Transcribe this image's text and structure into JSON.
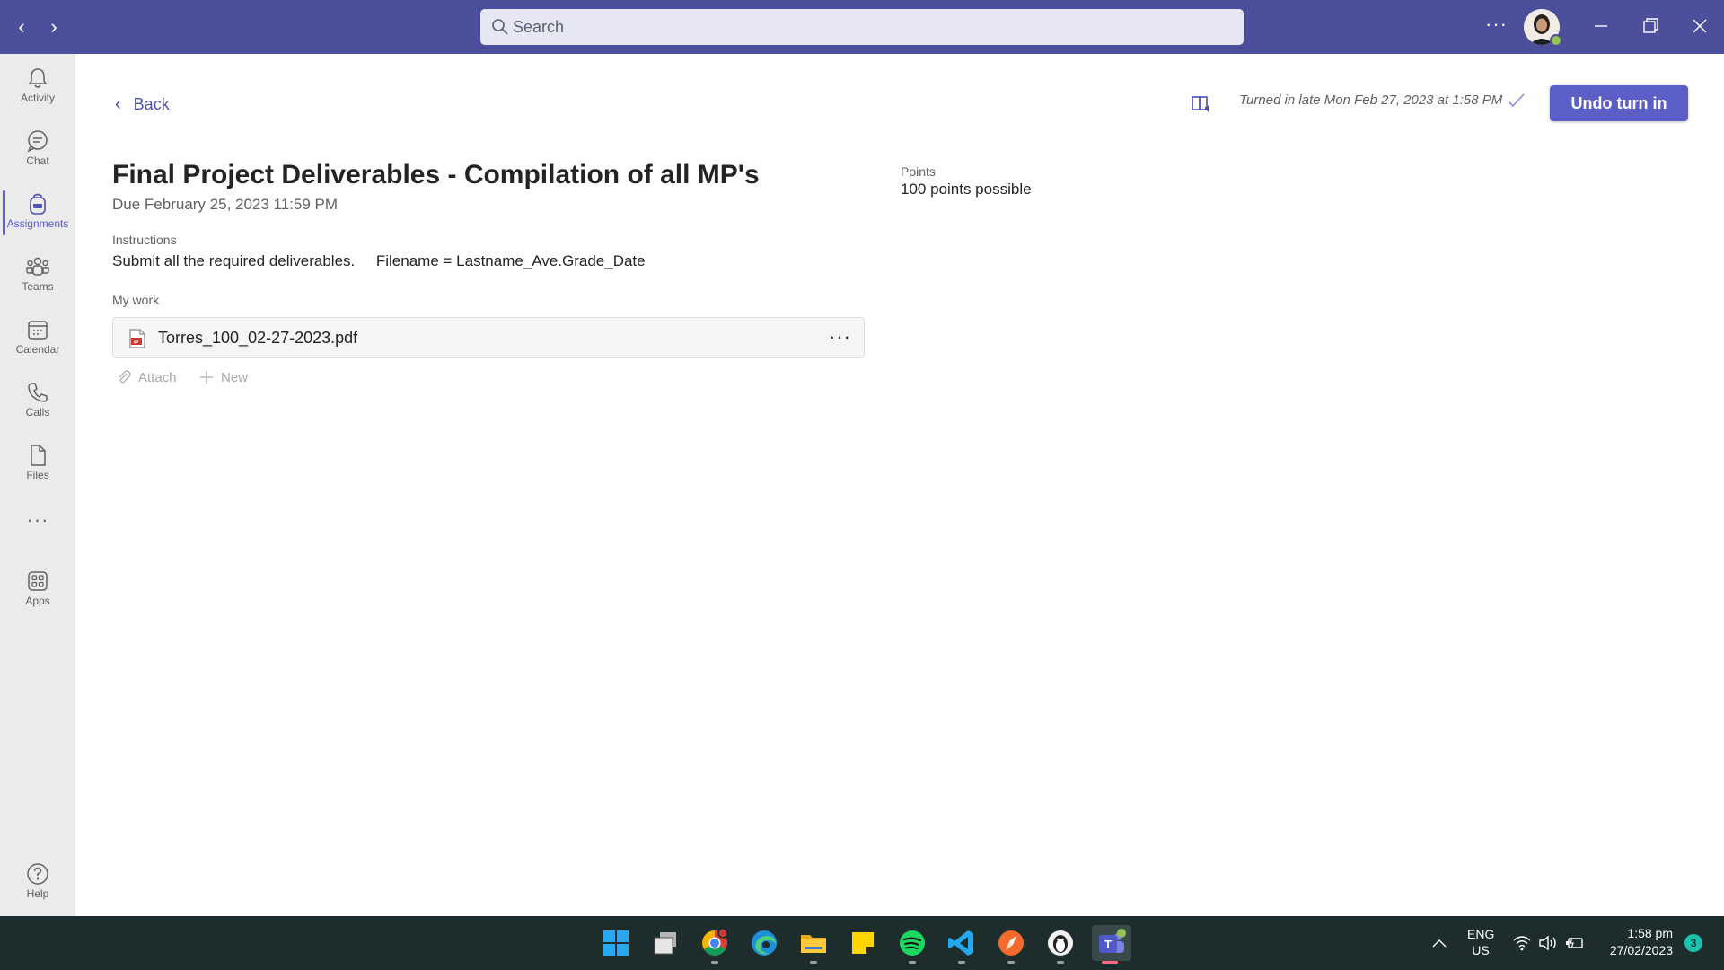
{
  "titlebar": {
    "search_placeholder": "Search",
    "more_label": "···"
  },
  "rail": {
    "items": [
      {
        "label": "Activity",
        "icon": "bell-icon"
      },
      {
        "label": "Chat",
        "icon": "chat-icon"
      },
      {
        "label": "Assignments",
        "icon": "backpack-icon",
        "active": true
      },
      {
        "label": "Teams",
        "icon": "teams-icon"
      },
      {
        "label": "Calendar",
        "icon": "calendar-icon"
      },
      {
        "label": "Calls",
        "icon": "phone-icon"
      },
      {
        "label": "Files",
        "icon": "file-icon"
      },
      {
        "label": "Apps",
        "icon": "apps-icon"
      },
      {
        "label": "Help",
        "icon": "help-icon"
      }
    ],
    "more_label": "···"
  },
  "header": {
    "back_label": "Back",
    "status_text": "Turned in late Mon Feb 27, 2023 at 1:58 PM",
    "undo_label": "Undo turn in"
  },
  "assignment": {
    "title": "Final Project Deliverables - Compilation of all MP's",
    "due": "Due February 25, 2023 11:59 PM",
    "points_label": "Points",
    "points_value": "100 points possible",
    "instructions_label": "Instructions",
    "instructions_text": "Submit all the required deliverables.     Filename = Lastname_Ave.Grade_Date",
    "my_work_label": "My work",
    "file_name": "Torres_100_02-27-2023.pdf",
    "file_more": "···",
    "attach_label": "Attach",
    "new_label": "New"
  },
  "taskbar": {
    "apps": [
      "start-icon",
      "task-view-icon",
      "chrome-icon",
      "edge-icon",
      "file-explorer-icon",
      "sticky-notes-icon",
      "spotify-icon",
      "vscode-icon",
      "compass-app-icon",
      "penguin-app-icon",
      "teams-app-icon"
    ],
    "lang_top": "ENG",
    "lang_bottom": "US",
    "time": "1:58 pm",
    "date": "27/02/2023",
    "notification_count": "3"
  },
  "colors": {
    "titlebar": "#4b4f9c",
    "accent": "#5b5fc7",
    "rail": "#ebebeb",
    "taskbar": "#1d2c2c"
  }
}
